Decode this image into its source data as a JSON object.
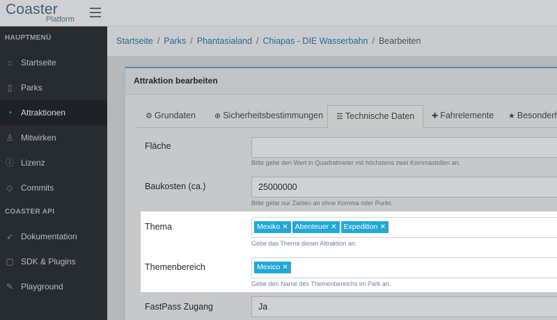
{
  "header": {
    "logo_main": "Coaster",
    "logo_sub": "Platform"
  },
  "sidebar": {
    "section_main": "HAUPTMENÜ",
    "section_api": "COASTER API",
    "items": [
      {
        "label": "Startseite",
        "icon": "home-icon"
      },
      {
        "label": "Parks",
        "icon": "map-icon"
      },
      {
        "label": "Attraktionen",
        "icon": "gauge-icon",
        "active": true
      },
      {
        "label": "Mitwirken",
        "icon": "users-icon"
      },
      {
        "label": "Lizenz",
        "icon": "info-icon"
      },
      {
        "label": "Commits",
        "icon": "tag-icon"
      }
    ],
    "api_items": [
      {
        "label": "Dokumentation",
        "icon": "rocket-icon"
      },
      {
        "label": "SDK & Plugins",
        "icon": "puzzle-icon"
      },
      {
        "label": "Playground",
        "icon": "pencil-icon"
      }
    ]
  },
  "breadcrumb": {
    "items": [
      "Startseite",
      "Parks",
      "Phantasialand",
      "Chiapas - DIE Wasserbahn"
    ],
    "current": "Bearbeiten"
  },
  "card": {
    "title": "Attraktion bearbeiten"
  },
  "tabs": [
    {
      "label": "Grundaten",
      "icon": "cogs-icon"
    },
    {
      "label": "Sicherheitsbestimmungen",
      "icon": "lifebuoy-icon"
    },
    {
      "label": "Technische Daten",
      "icon": "list-icon",
      "active": true
    },
    {
      "label": "Fahrelemente",
      "icon": "puzzle-icon"
    },
    {
      "label": "Besonderh",
      "icon": "star-icon"
    }
  ],
  "form": {
    "flaeche": {
      "label": "Fläche",
      "value": "",
      "help": "Bitte gebe den Wert in Quadratmeter mit höchstens zwei Kommastellen an."
    },
    "baukosten": {
      "label": "Baukosten (ca.)",
      "value": "25000000",
      "help": "Bitte gebe nur Zahlen an ohne Komma oder Punkt."
    },
    "thema": {
      "label": "Thema",
      "tags": [
        "Mexiko",
        "Abenteuer",
        "Expedition"
      ],
      "help": "Gebe das Thema dieser Attraktion an."
    },
    "themenbereich": {
      "label": "Themenbereich",
      "tags": [
        "Mexico"
      ],
      "help": "Gebe den Name des Themenbereichs im Park an."
    },
    "fastpass": {
      "label": "FastPass Zugang",
      "value": "Ja"
    }
  },
  "colors": {
    "accent": "#20a8d8",
    "sidebar_bg": "#272c31",
    "link": "#1e6e96"
  }
}
